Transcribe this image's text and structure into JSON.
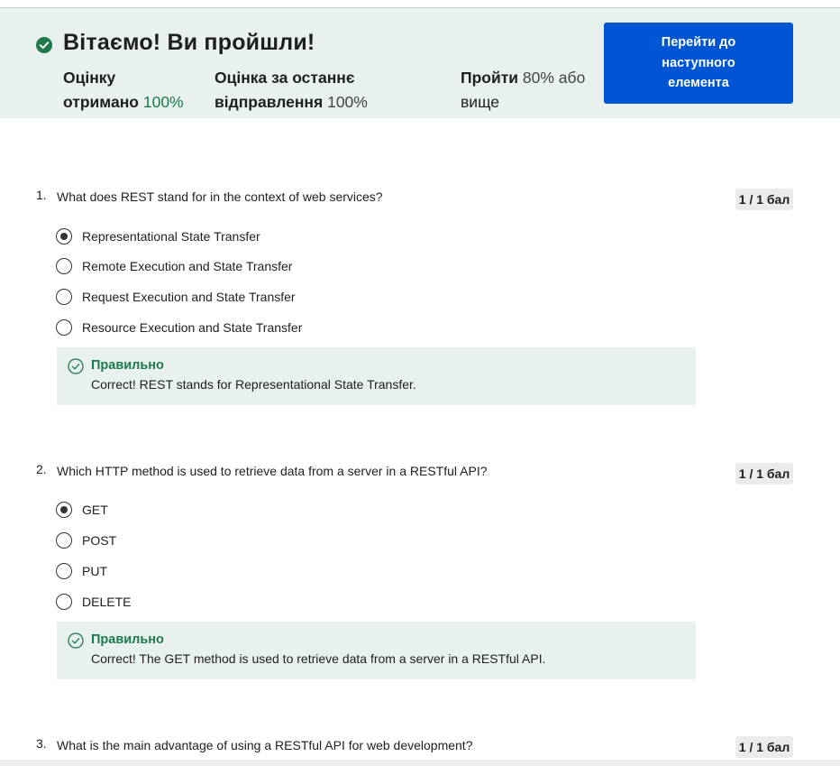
{
  "banner": {
    "title": "Вітаємо! Ви пройшли!",
    "stats": [
      {
        "label_line1": "Оцінку",
        "label_line2": "отримано",
        "value": "100%"
      },
      {
        "label_line1": "Оцінка за останнє",
        "label_line2": "відправлення",
        "value": "100%"
      },
      {
        "label": "Пройти",
        "value": "80% або",
        "suffix": "вище"
      }
    ],
    "next_button": "Перейти до наступного елемента"
  },
  "questions": [
    {
      "number": "1.",
      "text": "What does REST stand for in the context of web services?",
      "score": "1 / 1 бал",
      "options": [
        {
          "label": "Representational State Transfer",
          "selected": true
        },
        {
          "label": "Remote Execution and State Transfer",
          "selected": false
        },
        {
          "label": "Request Execution and State Transfer",
          "selected": false
        },
        {
          "label": "Resource Execution and State Transfer",
          "selected": false
        }
      ],
      "feedback": {
        "title": "Правильно",
        "text": "Correct! REST stands for Representational State Transfer."
      }
    },
    {
      "number": "2.",
      "text": "Which HTTP method is used to retrieve data from a server in a RESTful API?",
      "score": "1 / 1 бал",
      "options": [
        {
          "label": "GET",
          "selected": true
        },
        {
          "label": "POST",
          "selected": false
        },
        {
          "label": "PUT",
          "selected": false
        },
        {
          "label": "DELETE",
          "selected": false
        }
      ],
      "feedback": {
        "title": "Правильно",
        "text": "Correct! The GET method is used to retrieve data from a server in a RESTful API."
      }
    },
    {
      "number": "3.",
      "text": "What is the main advantage of using a RESTful API for web development?",
      "score": "1 / 1 бал"
    }
  ],
  "colors": {
    "success": "#1e7a4a",
    "primary": "#0056d2",
    "banner_bg": "#e8f1ed"
  },
  "icons": {
    "banner": "check-circle-filled-icon",
    "feedback": "check-circle-outline-icon"
  }
}
